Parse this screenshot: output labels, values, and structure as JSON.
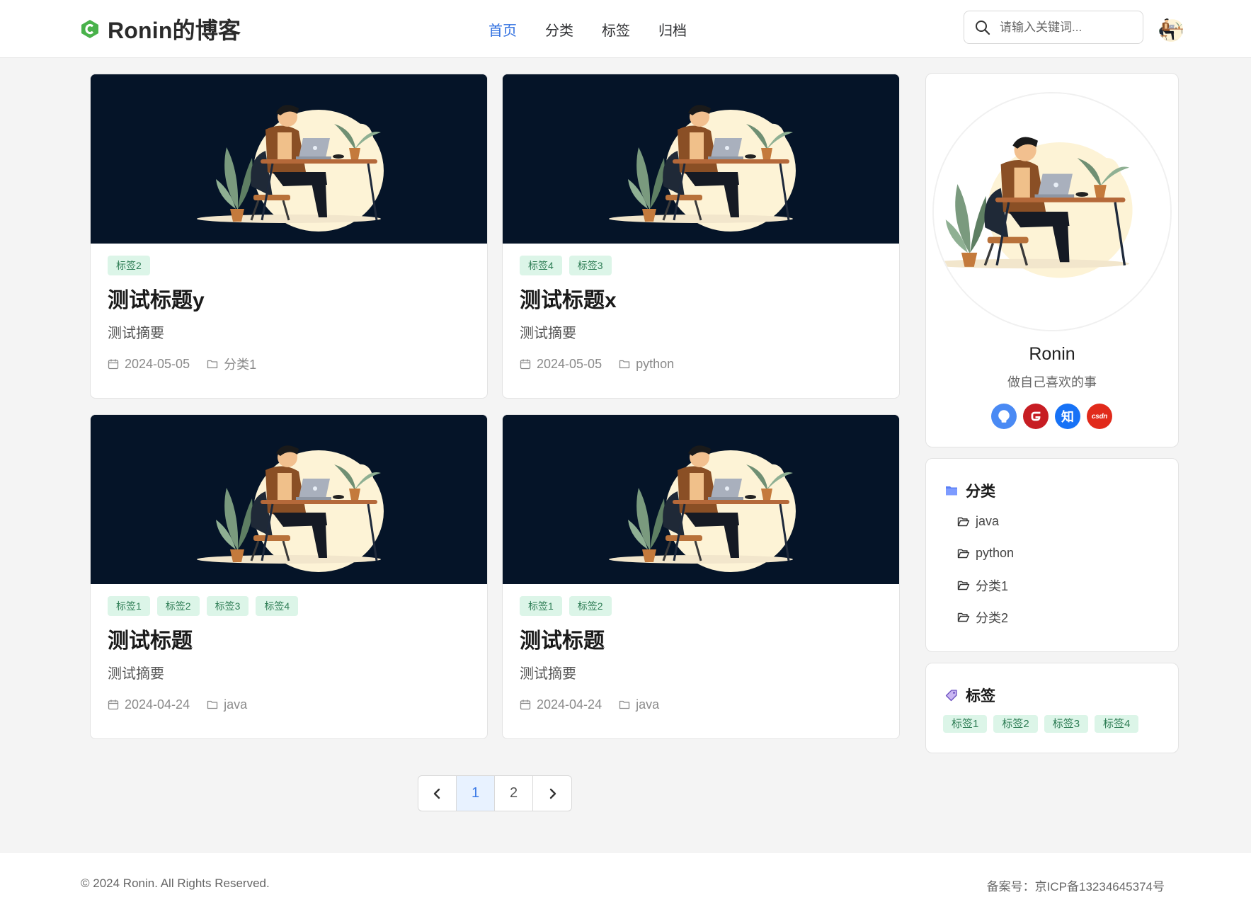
{
  "site": {
    "title": "Ronin的博客",
    "brand_color": "#2f6fe0"
  },
  "nav": [
    {
      "label": "首页",
      "active": true
    },
    {
      "label": "分类",
      "active": false
    },
    {
      "label": "标签",
      "active": false
    },
    {
      "label": "归档",
      "active": false
    }
  ],
  "search": {
    "placeholder": "请输入关键词..."
  },
  "posts": [
    {
      "tags": [
        "标签2"
      ],
      "title": "测试标题y",
      "summary": "测试摘要",
      "date": "2024-05-05",
      "category": "分类1"
    },
    {
      "tags": [
        "标签4",
        "标签3"
      ],
      "title": "测试标题x",
      "summary": "测试摘要",
      "date": "2024-05-05",
      "category": "python"
    },
    {
      "tags": [
        "标签1",
        "标签2",
        "标签3",
        "标签4"
      ],
      "title": "测试标题",
      "summary": "测试摘要",
      "date": "2024-04-24",
      "category": "java"
    },
    {
      "tags": [
        "标签1",
        "标签2"
      ],
      "title": "测试标题",
      "summary": "测试摘要",
      "date": "2024-04-24",
      "category": "java"
    }
  ],
  "pagination": {
    "pages": [
      "1",
      "2"
    ],
    "current": "1"
  },
  "profile": {
    "name": "Ronin",
    "motto": "做自己喜欢的事",
    "socials": [
      {
        "name": "github",
        "icon": "github-icon",
        "glyph": ""
      },
      {
        "name": "gitee",
        "icon": "gitee-icon",
        "glyph": ""
      },
      {
        "name": "zhihu",
        "icon": "zhihu-icon",
        "glyph": "知"
      },
      {
        "name": "csdn",
        "icon": "csdn-icon",
        "glyph": "csdn"
      }
    ]
  },
  "categories_panel": {
    "title": "分类",
    "items": [
      "java",
      "python",
      "分类1",
      "分类2"
    ]
  },
  "tags_panel": {
    "title": "标签",
    "items": [
      "标签1",
      "标签2",
      "标签3",
      "标签4"
    ]
  },
  "footer": {
    "copyright": "© 2024 Ronin. All Rights Reserved.",
    "icp": "备案号：京ICP备13234645374号"
  }
}
